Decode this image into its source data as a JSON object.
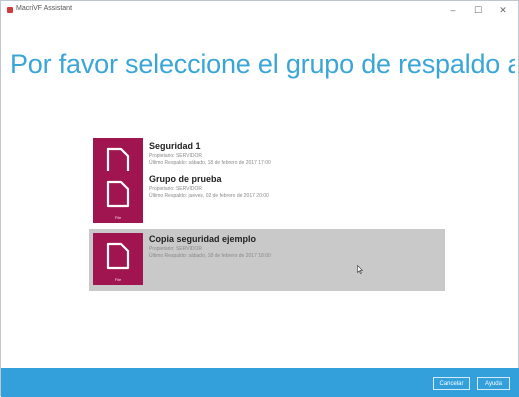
{
  "window": {
    "title": "MacriVF Assistant",
    "minimize_glyph": "–",
    "maximize_glyph": "☐",
    "close_glyph": "✕"
  },
  "heading": "Por favor seleccione el grupo de respaldo a r...",
  "groups": [
    {
      "name": "Seguridad 1",
      "owner": "Propietario: SERVIDOR",
      "last_backup": "Último Respaldo: sábado, 18 de febrero de 2017 17:00",
      "tile_label": "File",
      "selected": false
    },
    {
      "name": "Grupo de prueba",
      "owner": "Propietario: SERVIDOR",
      "last_backup": "Último Respaldo: jueves, 02 de febrero de 2017 20:00",
      "tile_label": "File",
      "selected": false
    },
    {
      "name": "Copia seguridad ejemplo",
      "owner": "Propietario: SERVIDOR",
      "last_backup": "Último Respaldo: sábado, 18 de febrero de 2017 18:00",
      "tile_label": "File",
      "selected": true
    }
  ],
  "footer": {
    "cancel_label": "Cancelar",
    "help_label": "Ayuda"
  },
  "colors": {
    "accent": "#33a0dc",
    "tile": "#a0154f",
    "selected_bg": "#c9c9c9",
    "heading": "#3aa6d8"
  },
  "icons": [
    "app-icon",
    "file-icon",
    "mouse-cursor-icon"
  ]
}
